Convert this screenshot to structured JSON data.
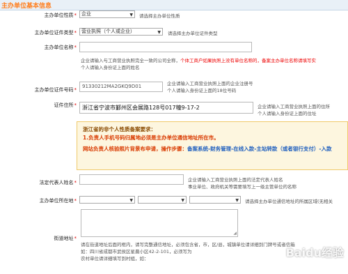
{
  "header": {
    "title": "主办单位基本信息"
  },
  "form": {
    "unit_type": {
      "label": "主办单位性质",
      "value": "企业",
      "hint": "请选择主办单位性质"
    },
    "cert_type": {
      "label": "主办单位证件类型",
      "value": "营业执照（个人或企业）",
      "hint": "请选择主办单位证件类型"
    },
    "unit_name": {
      "label": "主办单位名称",
      "value": "",
      "hint1_a": "企业请输入与工商营业执照完全一致的公司全称，",
      "hint1_b": "个体工商户如果执照上没有单位名称的，备案主办单位名称请填写实",
      "hint2": "个人请输入身份证上面的姓名"
    },
    "cert_no": {
      "label": "主办单位证件号码",
      "value": "91330212MA2GKQ9D01",
      "hint1": "企业请输入工商营业执照上面的企业注册号",
      "hint2": "个人请输入身份证上面的18位号码"
    },
    "cert_addr": {
      "label": "证件住所",
      "value": "浙江省宁波市鄞州区会展路128号017幢9-17-2",
      "hint1": "企业请输入工商营业执照上面的住所",
      "hint2": "个人请输入身份证上面的住址"
    },
    "notice": {
      "title": "浙江省的非个人性质备案要求：",
      "line1": "1.负责人手机号码归属地必须是主办单位通信地址所在市。",
      "line2_a": "网站负责人核验照片背景布申请，操作步骤：",
      "line2_b": "备案系统-财务管理-在线入款-主站转款（或者银行支付）-入款"
    },
    "legal_rep": {
      "label": "法定代表人姓名",
      "value": "",
      "hint1": "企业请输入工商营业执照上面的法定代表人姓名",
      "hint2": "事业单位、政府机关等需要填写上一级主管单位的名称"
    },
    "location": {
      "label": "主办单位所在地",
      "value": "",
      "hint": "请选择主办单位通信地址的所属区域(无相关"
    },
    "street": {
      "label": "街道地址",
      "hint1": "请在街道地址后面的框内，请写完整通信地址，必须包含省，市，区/县，城镇单位请详细到门牌号或者信箱",
      "hint2": "如：四川省成都市武侯区星晨小区42-2-101，必须写为",
      "hint3": "农村单位请详细填写到村组，如："
    }
  },
  "watermark": "Baidu经验"
}
